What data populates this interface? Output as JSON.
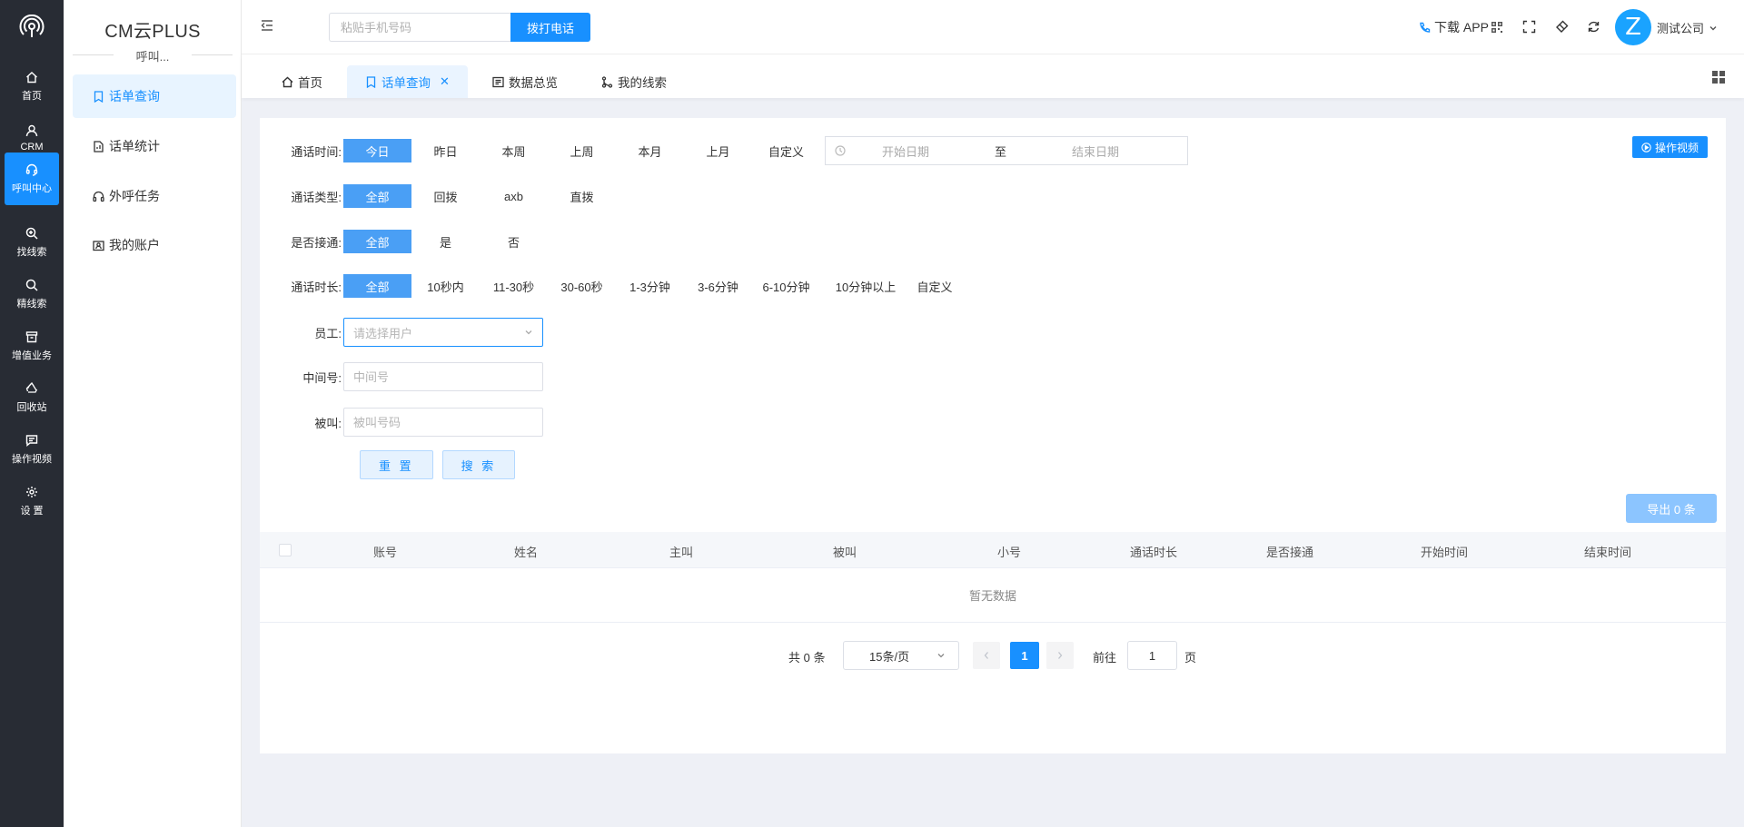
{
  "rail": {
    "items": [
      {
        "label": "首页",
        "icon": "home-icon"
      },
      {
        "label": "CRM",
        "icon": "user-icon"
      },
      {
        "label": "呼叫中心",
        "icon": "headset-icon"
      },
      {
        "label": "找线索",
        "icon": "search-plus-icon"
      },
      {
        "label": "精线索",
        "icon": "search-icon"
      },
      {
        "label": "增值业务",
        "icon": "archive-icon"
      },
      {
        "label": "回收站",
        "icon": "recycle-icon"
      },
      {
        "label": "操作视频",
        "icon": "chat-icon"
      },
      {
        "label": "设 置",
        "icon": "gear-icon"
      }
    ],
    "active_index": 2
  },
  "sidebar": {
    "brand": "CM云PLUS",
    "section": "呼叫...",
    "items": [
      {
        "label": "话单查询"
      },
      {
        "label": "话单统计"
      },
      {
        "label": "外呼任务"
      },
      {
        "label": "我的账户"
      }
    ]
  },
  "header": {
    "phone_placeholder": "粘贴手机号码",
    "dial_label": "拨打电话",
    "download_label": "下载 APP",
    "avatar_letter": "Z",
    "company": "测试公司"
  },
  "tabs": [
    {
      "label": "首页"
    },
    {
      "label": "话单查询"
    },
    {
      "label": "数据总览"
    },
    {
      "label": "我的线索"
    }
  ],
  "filters": {
    "time_label": "通话时间:",
    "time_options": [
      "今日",
      "昨日",
      "本周",
      "上周",
      "本月",
      "上月",
      "自定义"
    ],
    "date_start": "开始日期",
    "date_sep": "至",
    "date_end": "结束日期",
    "type_label": "通话类型:",
    "type_options": [
      "全部",
      "回拨",
      "axb",
      "直拨"
    ],
    "connected_label": "是否接通:",
    "connected_options": [
      "全部",
      "是",
      "否"
    ],
    "duration_label": "通话时长:",
    "duration_options": [
      "全部",
      "10秒内",
      "11-30秒",
      "30-60秒",
      "1-3分钟",
      "3-6分钟",
      "6-10分钟",
      "10分钟以上",
      "自定义"
    ],
    "staff_label": "员工:",
    "staff_placeholder": "请选择用户",
    "middle_label": "中间号:",
    "middle_placeholder": "中间号",
    "callee_label": "被叫:",
    "callee_placeholder": "被叫号码",
    "reset_label": "重 置",
    "search_label": "搜 索",
    "video_label": "操作视频"
  },
  "table": {
    "export_label": "导出 0 条",
    "columns": [
      "账号",
      "姓名",
      "主叫",
      "被叫",
      "小号",
      "通话时长",
      "是否接通",
      "开始时间",
      "结束时间"
    ],
    "empty_text": "暂无数据"
  },
  "pagination": {
    "total": "共 0 条",
    "page_size": "15条/页",
    "current_page": "1",
    "goto_label": "前往",
    "goto_value": "1",
    "goto_unit": "页"
  },
  "colors": {
    "primary": "#1890ff",
    "rail_bg": "#282c34",
    "option_selected": "#4a9ff5",
    "page_bg": "#eef0f6"
  }
}
